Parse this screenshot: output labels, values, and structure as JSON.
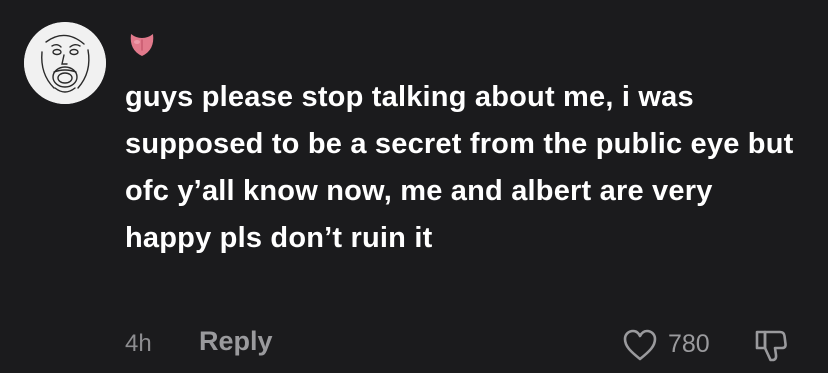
{
  "comment": {
    "text": "guys please stop talking about me, i was supposed to be a secret from the public eye but ofc y’all know now, me and albert are very happy pls don’t ruin it",
    "avatar_icon": "sketch-face-avatar",
    "badge_icon": "tongue-emoji-icon"
  },
  "footer": {
    "timestamp": "4h",
    "reply_label": "Reply",
    "like_count": "780",
    "like_icon": "heart-outline-icon",
    "dislike_icon": "thumbs-down-icon"
  },
  "colors": {
    "background": "#1b1b1d",
    "text": "#ffffff",
    "muted": "#9a9a9d",
    "emoji": "#e27a8c"
  }
}
